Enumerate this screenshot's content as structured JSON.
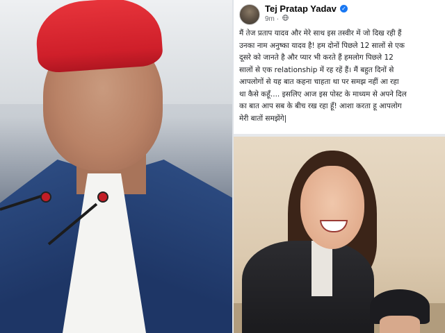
{
  "post": {
    "author": "Tej Pratap Yadav",
    "time": "9m",
    "verified_icon": "verified-badge-icon",
    "privacy_icon": "globe-icon",
    "text_lines": [
      "मैं तेज प्रताप यादव और  मेरे साथ इस तस्वीर में जो दिख रही हैं",
      "उनका नाम अनुष्का यादव है! हम दोनों पिछले 12 सालों से एक",
      "दूसरे को जानते है और प्यार भी करते हैं हमलोग पिछले 12",
      "सालों से एक relationship में रह रहें हैं। मैं बहुत दिनों से",
      "आपलोगों से यह बात कहना चाहता था पर समझ नहीं आ रहा",
      "था कैसे कहूँ.... इसलिए आज इस पोस्ट के माध्यम से अपने दिल",
      "का बात आप सब के बीच रख रहा हूँ! आशा करता हू आपलोग",
      "मेरी बातों समझेंगे|"
    ]
  },
  "colors": {
    "cap_red": "#d9252f",
    "jacket_blue": "#1e3666",
    "verified_blue": "#1877f2"
  }
}
